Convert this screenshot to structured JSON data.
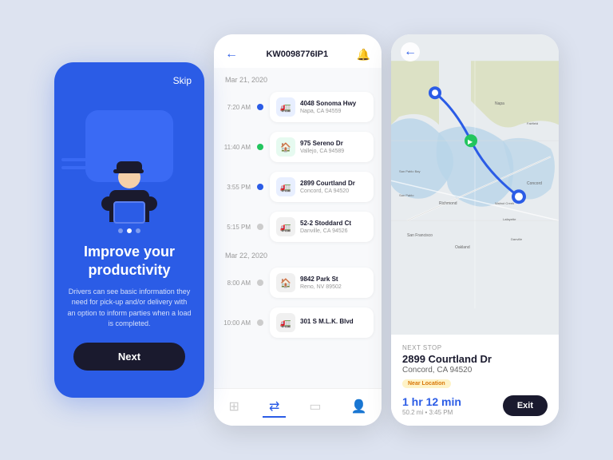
{
  "screen1": {
    "skip_label": "Skip",
    "title": "Improve your productivity",
    "description": "Drivers can see basic information they need for pick-up and/or delivery with an option to inform parties when a load is completed.",
    "next_button": "Next",
    "dots": [
      false,
      true,
      false
    ]
  },
  "screen2": {
    "back_icon": "←",
    "route_id": "KW0098776IP1",
    "bell_icon": "🔔",
    "date1": "Mar 21, 2020",
    "stops": [
      {
        "time": "7:20 AM",
        "dot": "blue",
        "icon_type": "blue-bg",
        "icon": "🚛",
        "address": "4048 Sonoma Hwy",
        "city": "Napa, CA 94559"
      },
      {
        "time": "11:40 AM",
        "dot": "green",
        "icon_type": "green-bg",
        "icon": "🏠",
        "address": "975 Sereno Dr",
        "city": "Vallejo, CA 94589"
      },
      {
        "time": "3:55 PM",
        "dot": "blue",
        "icon_type": "blue-bg",
        "icon": "🚛",
        "address": "2899 Courtland Dr",
        "city": "Concord, CA 94520"
      },
      {
        "time": "5:15 PM",
        "dot": "gray",
        "icon_type": "gray-bg",
        "icon": "🚛",
        "address": "52-2 Stoddard Ct",
        "city": "Danville, CA 94526"
      }
    ],
    "date2": "Mar 22, 2020",
    "stops2": [
      {
        "time": "8:00 AM",
        "dot": "gray",
        "icon_type": "gray-bg",
        "icon": "🏠",
        "address": "9842 Park St",
        "city": "Reno, NV 89502"
      },
      {
        "time": "10:00 AM",
        "dot": "gray",
        "icon_type": "gray-bg",
        "icon": "🚛",
        "address": "301 S M.L.K. Blvd",
        "city": ""
      }
    ],
    "nav_items": [
      "grid",
      "route",
      "box",
      "person"
    ]
  },
  "screen3": {
    "back_icon": "←",
    "next_stop_label": "Next stop",
    "address": "2899 Courtland Dr",
    "city": "Concord, CA 94520",
    "near_badge": "Near Location",
    "eta_time": "1 hr 12 min",
    "eta_distance": "50.2 mi",
    "eta_clock": "3:45 PM",
    "exit_button": "Exit"
  }
}
